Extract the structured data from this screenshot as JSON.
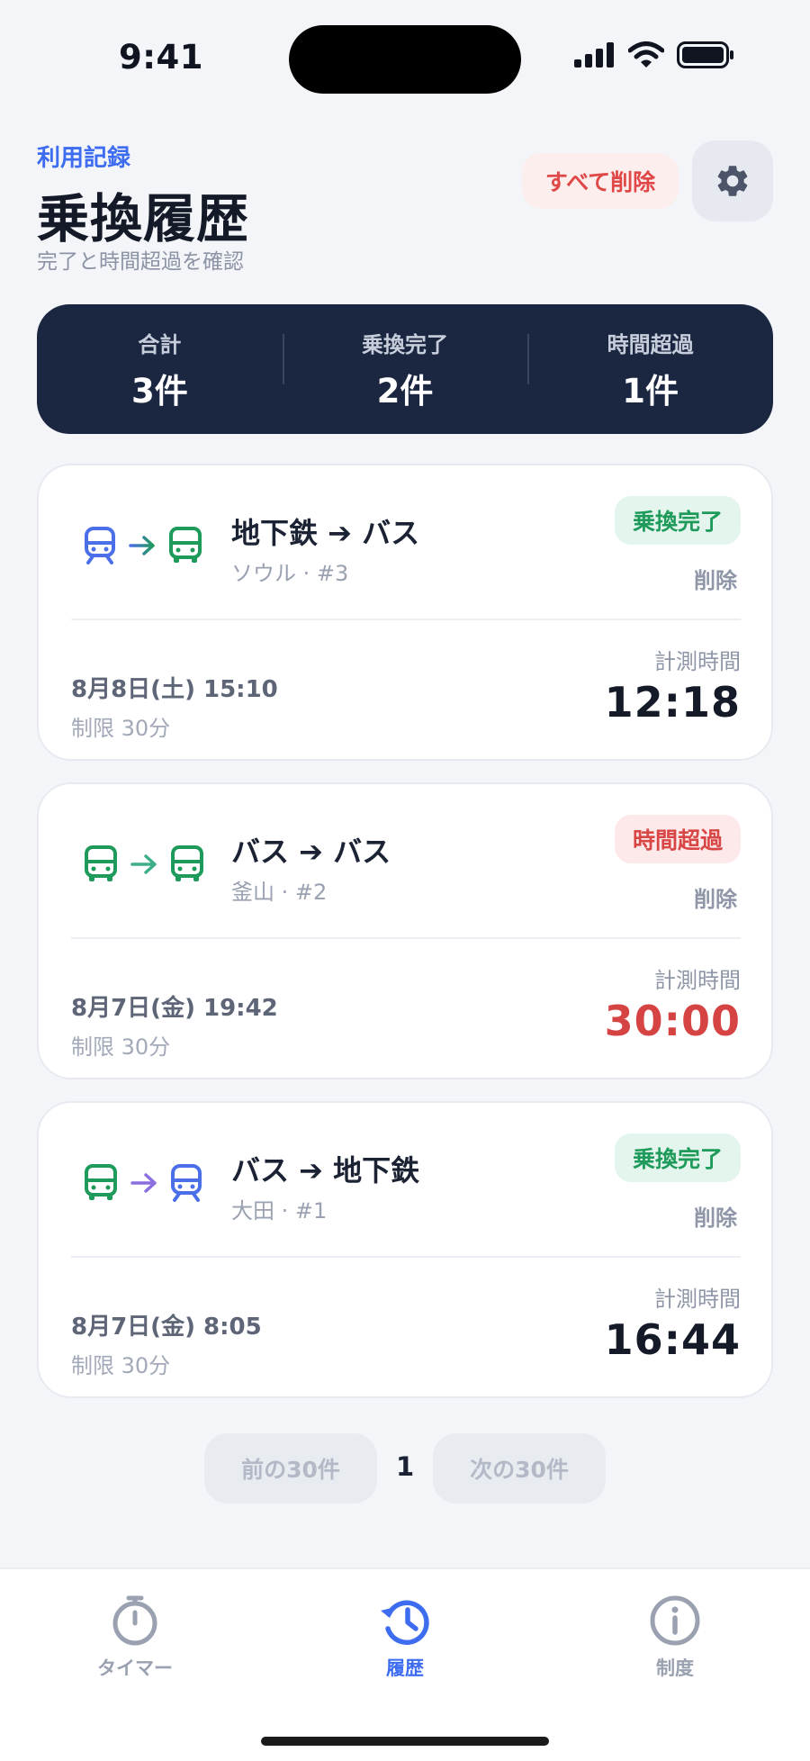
{
  "status_bar": {
    "time": "9:41"
  },
  "header": {
    "eyebrow": "利用記録",
    "title": "乗換履歴",
    "subtitle": "完了と時間超過を確認",
    "delete_all_label": "すべて削除"
  },
  "summary": [
    {
      "label": "合計",
      "value": "3件"
    },
    {
      "label": "乗換完了",
      "value": "2件"
    },
    {
      "label": "時間超過",
      "value": "1件"
    }
  ],
  "records": [
    {
      "from_icon": "subway-icon",
      "to_icon": "bus-icon",
      "title": "地下鉄 ➔ バス",
      "sub": "ソウル · #3",
      "status": "乗換完了",
      "status_type": "done",
      "delete_label": "削除",
      "date": "8月8日(土) 15:10",
      "limit": "制限 30分",
      "measure_label": "計測時間",
      "measure_value": "12:18"
    },
    {
      "from_icon": "bus-icon",
      "to_icon": "bus-icon",
      "title": "バス ➔ バス",
      "sub": "釜山 · #2",
      "status": "時間超過",
      "status_type": "over",
      "delete_label": "削除",
      "date": "8月7日(金) 19:42",
      "limit": "制限 30分",
      "measure_label": "計測時間",
      "measure_value": "30:00"
    },
    {
      "from_icon": "bus-icon",
      "to_icon": "subway-icon",
      "title": "バス ➔ 地下鉄",
      "sub": "大田 · #1",
      "status": "乗換完了",
      "status_type": "done",
      "delete_label": "削除",
      "date": "8月7日(金) 8:05",
      "limit": "制限 30分",
      "measure_label": "計測時間",
      "measure_value": "16:44"
    }
  ],
  "pagination": {
    "prev_label": "前の30件",
    "page": "1",
    "next_label": "次の30件"
  },
  "tabs": [
    {
      "label": "タイマー",
      "icon": "stopwatch-icon",
      "active": false
    },
    {
      "label": "履歴",
      "icon": "history-icon",
      "active": true
    },
    {
      "label": "制度",
      "icon": "info-icon",
      "active": false
    }
  ],
  "colors": {
    "accent": "#3d6cf0",
    "subway": "#4a6fe8",
    "bus": "#1e9a5a",
    "danger": "#d64343",
    "summary_bg": "#1b2640"
  }
}
